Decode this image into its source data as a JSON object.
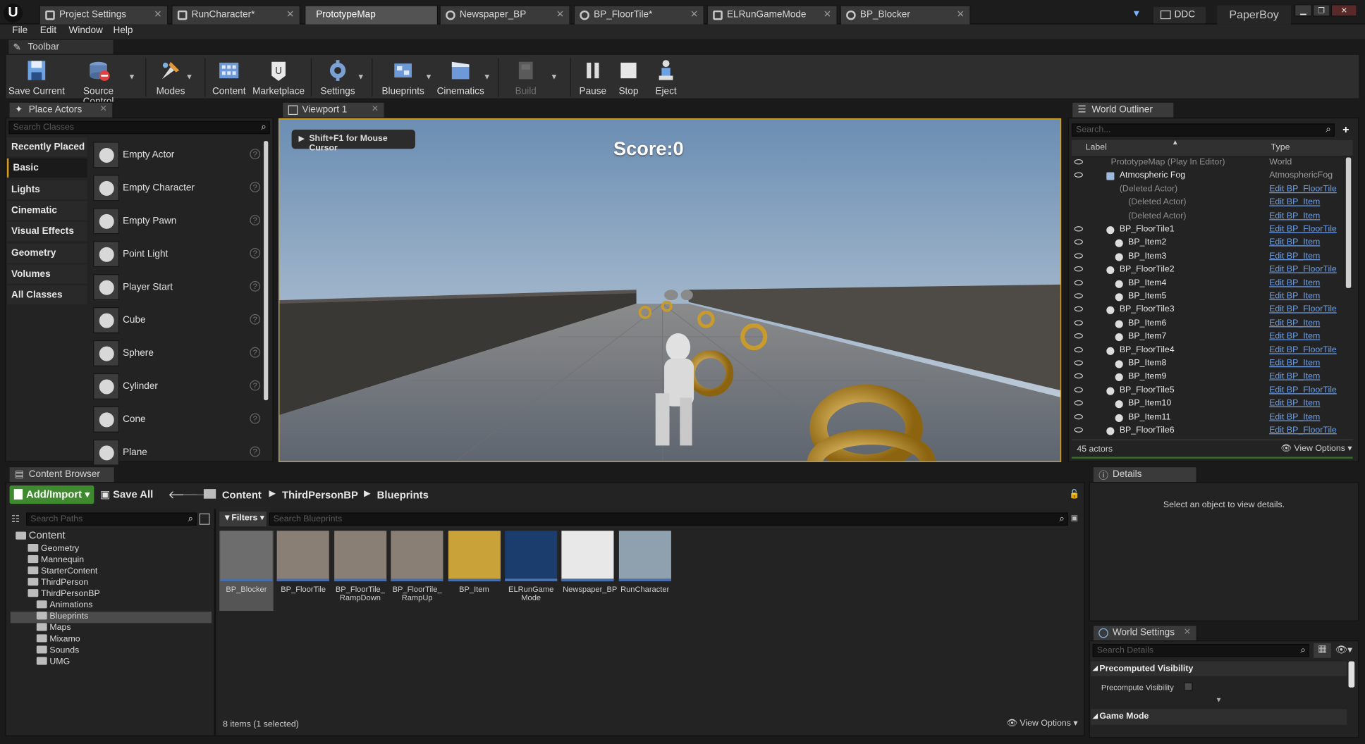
{
  "tabs": [
    {
      "label": "Project Settings"
    },
    {
      "label": "RunCharacter*"
    },
    {
      "label": "PrototypeMap"
    },
    {
      "label": "Newspaper_BP"
    },
    {
      "label": "BP_FloorTile*"
    },
    {
      "label": "ELRunGameMode"
    },
    {
      "label": "BP_Blocker"
    }
  ],
  "app": {
    "logo": "U",
    "ddc": "DDC",
    "project": "PaperBoy"
  },
  "menu": [
    "File",
    "Edit",
    "Window",
    "Help"
  ],
  "toolbar": {
    "tab_label": "Toolbar",
    "buttons": [
      {
        "label": "Save Current",
        "icon": "save-icon"
      },
      {
        "label": "Source Control",
        "icon": "source-control-icon"
      },
      {
        "label": "Modes",
        "icon": "modes-icon"
      },
      {
        "label": "Content",
        "icon": "content-icon"
      },
      {
        "label": "Marketplace",
        "icon": "marketplace-icon"
      },
      {
        "label": "Settings",
        "icon": "settings-icon"
      },
      {
        "label": "Blueprints",
        "icon": "blueprints-icon"
      },
      {
        "label": "Cinematics",
        "icon": "cinematics-icon"
      },
      {
        "label": "Build",
        "icon": "build-icon"
      },
      {
        "label": "Pause",
        "icon": "pause-icon"
      },
      {
        "label": "Stop",
        "icon": "stop-icon"
      },
      {
        "label": "Eject",
        "icon": "eject-icon"
      }
    ]
  },
  "place_actors": {
    "tab_label": "Place Actors",
    "search_placeholder": "Search Classes",
    "categories": [
      "Recently Placed",
      "Basic",
      "Lights",
      "Cinematic",
      "Visual Effects",
      "Geometry",
      "Volumes",
      "All Classes"
    ],
    "active_category": "Basic",
    "items": [
      "Empty Actor",
      "Empty Character",
      "Empty Pawn",
      "Point Light",
      "Player Start",
      "Cube",
      "Sphere",
      "Cylinder",
      "Cone",
      "Plane"
    ]
  },
  "viewport": {
    "tab_label": "Viewport 1",
    "hint": "Shift+F1 for Mouse Cursor",
    "score": "Score:0"
  },
  "outliner": {
    "tab_label": "World Outliner",
    "search_placeholder": "Search...",
    "col_label": "Label",
    "col_type": "Type",
    "rows": [
      {
        "label": "PrototypeMap (Play In Editor)",
        "type": "World",
        "indent": 0,
        "link": false,
        "dim": true
      },
      {
        "label": "Atmospheric Fog",
        "type": "AtmosphericFog",
        "indent": 1,
        "link": false,
        "dim": false
      },
      {
        "label": "(Deleted Actor)",
        "type": "Edit BP_FloorTile",
        "indent": 1,
        "link": true,
        "dim": true
      },
      {
        "label": "(Deleted Actor)",
        "type": "Edit BP_Item",
        "indent": 2,
        "link": true,
        "dim": true
      },
      {
        "label": "(Deleted Actor)",
        "type": "Edit BP_Item",
        "indent": 2,
        "link": true,
        "dim": true
      },
      {
        "label": "BP_FloorTile1",
        "type": "Edit BP_FloorTile",
        "indent": 1,
        "link": true,
        "dim": false
      },
      {
        "label": "BP_Item2",
        "type": "Edit BP_Item",
        "indent": 2,
        "link": true,
        "dim": false
      },
      {
        "label": "BP_Item3",
        "type": "Edit BP_Item",
        "indent": 2,
        "link": true,
        "dim": false
      },
      {
        "label": "BP_FloorTile2",
        "type": "Edit BP_FloorTile",
        "indent": 1,
        "link": true,
        "dim": false
      },
      {
        "label": "BP_Item4",
        "type": "Edit BP_Item",
        "indent": 2,
        "link": true,
        "dim": false
      },
      {
        "label": "BP_Item5",
        "type": "Edit BP_Item",
        "indent": 2,
        "link": true,
        "dim": false
      },
      {
        "label": "BP_FloorTile3",
        "type": "Edit BP_FloorTile",
        "indent": 1,
        "link": true,
        "dim": false
      },
      {
        "label": "BP_Item6",
        "type": "Edit BP_Item",
        "indent": 2,
        "link": true,
        "dim": false
      },
      {
        "label": "BP_Item7",
        "type": "Edit BP_Item",
        "indent": 2,
        "link": true,
        "dim": false
      },
      {
        "label": "BP_FloorTile4",
        "type": "Edit BP_FloorTile",
        "indent": 1,
        "link": true,
        "dim": false
      },
      {
        "label": "BP_Item8",
        "type": "Edit BP_Item",
        "indent": 2,
        "link": true,
        "dim": false
      },
      {
        "label": "BP_Item9",
        "type": "Edit BP_Item",
        "indent": 2,
        "link": true,
        "dim": false
      },
      {
        "label": "BP_FloorTile5",
        "type": "Edit BP_FloorTile",
        "indent": 1,
        "link": true,
        "dim": false
      },
      {
        "label": "BP_Item10",
        "type": "Edit BP_Item",
        "indent": 2,
        "link": true,
        "dim": false
      },
      {
        "label": "BP_Item11",
        "type": "Edit BP_Item",
        "indent": 2,
        "link": true,
        "dim": false
      },
      {
        "label": "BP_FloorTile6",
        "type": "Edit BP_FloorTile",
        "indent": 1,
        "link": true,
        "dim": false
      }
    ],
    "count": "45 actors",
    "view_options": "View Options"
  },
  "content_browser": {
    "tab_label": "Content Browser",
    "add_import": "Add/Import",
    "save_all": "Save All",
    "breadcrumb": [
      "Content",
      "ThirdPersonBP",
      "Blueprints"
    ],
    "search_paths_placeholder": "Search Paths",
    "filters": "Filters",
    "search_assets_placeholder": "Search Blueprints",
    "tree": [
      {
        "label": "Content",
        "level": 0
      },
      {
        "label": "Geometry",
        "level": 1
      },
      {
        "label": "Mannequin",
        "level": 1
      },
      {
        "label": "StarterContent",
        "level": 1
      },
      {
        "label": "ThirdPerson",
        "level": 1
      },
      {
        "label": "ThirdPersonBP",
        "level": 1
      },
      {
        "label": "Animations",
        "level": 2
      },
      {
        "label": "Blueprints",
        "level": 2
      },
      {
        "label": "Maps",
        "level": 2
      },
      {
        "label": "Mixamo",
        "level": 2
      },
      {
        "label": "Sounds",
        "level": 2
      },
      {
        "label": "UMG",
        "level": 2
      }
    ],
    "assets": [
      {
        "label": "BP_Blocker"
      },
      {
        "label": "BP_FloorTile"
      },
      {
        "label": "BP_FloorTile_ RampDown"
      },
      {
        "label": "BP_FloorTile_ RampUp"
      },
      {
        "label": "BP_Item"
      },
      {
        "label": "ELRunGame Mode"
      },
      {
        "label": "Newspaper_BP"
      },
      {
        "label": "RunCharacter"
      }
    ],
    "status": "8 items (1 selected)",
    "view_options": "View Options"
  },
  "details": {
    "tab_label": "Details",
    "empty_text": "Select an object to view details."
  },
  "world_settings": {
    "tab_label": "World Settings",
    "search_placeholder": "Search Details",
    "section1": "Precomputed Visibility",
    "prop1": "Precompute Visibility",
    "section2": "Game Mode"
  },
  "colors": {
    "accent": "#d9a322",
    "link": "#6fa0e8",
    "add_button": "#3f8a2e"
  }
}
